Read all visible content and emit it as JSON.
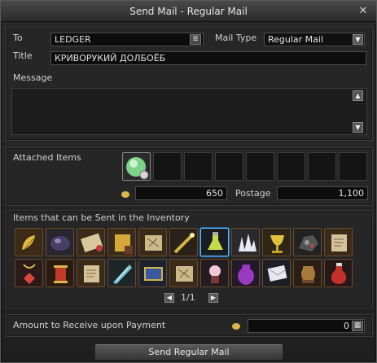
{
  "window": {
    "title": "Send Mail - Regular Mail",
    "close_icon": "close-icon"
  },
  "header": {
    "to_label": "To",
    "to_value": "LEDGER",
    "mail_type_label": "Mail Type",
    "mail_type_value": "Regular Mail",
    "title_label": "Title",
    "title_value": "КРИВОРУКИЙ ДОЛБОЁБ",
    "message_label": "Message",
    "message_value": ""
  },
  "attached": {
    "label": "Attached Items",
    "gold_amount": "650",
    "postage_label": "Postage",
    "postage_amount": "1,100"
  },
  "inventory": {
    "label": "Items that can be Sent in the Inventory",
    "page_indicator": "1/1",
    "items": [
      "gold-leaf-icon",
      "purple-gem-icon",
      "scroll-icon",
      "lettered-scroll-icon",
      "map-scroll-icon",
      "wand-icon",
      "potion-flask-icon",
      "crystal-cluster-icon",
      "golden-chalice-icon",
      "ore-icon",
      "parchment-icon",
      "amulet-icon",
      "lantern-icon",
      "parchment-icon",
      "ice-shard-icon",
      "blue-scroll-icon",
      "map-scroll-icon",
      "pink-orb-icon",
      "purple-vase-icon",
      "letter-icon",
      "urn-icon",
      "red-potion-icon"
    ]
  },
  "payment": {
    "label": "Amount to Receive upon Payment",
    "value": "0"
  },
  "footer": {
    "send_label": "Send Regular Mail"
  },
  "colors": {
    "accent_gold": "#d8b84a",
    "selection_blue": "#5fb6ff"
  }
}
